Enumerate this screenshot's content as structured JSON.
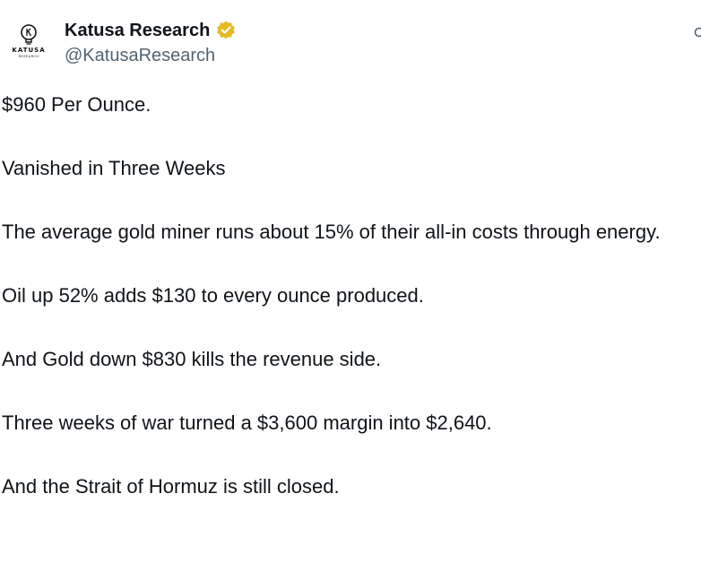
{
  "author": {
    "display_name": "Katusa Research",
    "handle": "@KatusaResearch",
    "verified_color": "#e8b923",
    "avatar_brand": "KATUSA",
    "avatar_sub": "RESEARCH"
  },
  "icons": {
    "verified": "gold-verified-badge-icon",
    "more": "search-icon",
    "avatar_symbol": "lightbulb-icon"
  },
  "tweet": {
    "paragraphs": [
      "$960 Per Ounce.",
      "Vanished in Three Weeks",
      "The average gold miner runs about 15% of their all-in costs through energy.",
      "Oil up 52% adds $130 to every ounce produced.",
      "And Gold down $830 kills the revenue side.",
      "Three weeks of war turned a $3,600 margin into $2,640.",
      "And the Strait of Hormuz is still closed."
    ]
  }
}
